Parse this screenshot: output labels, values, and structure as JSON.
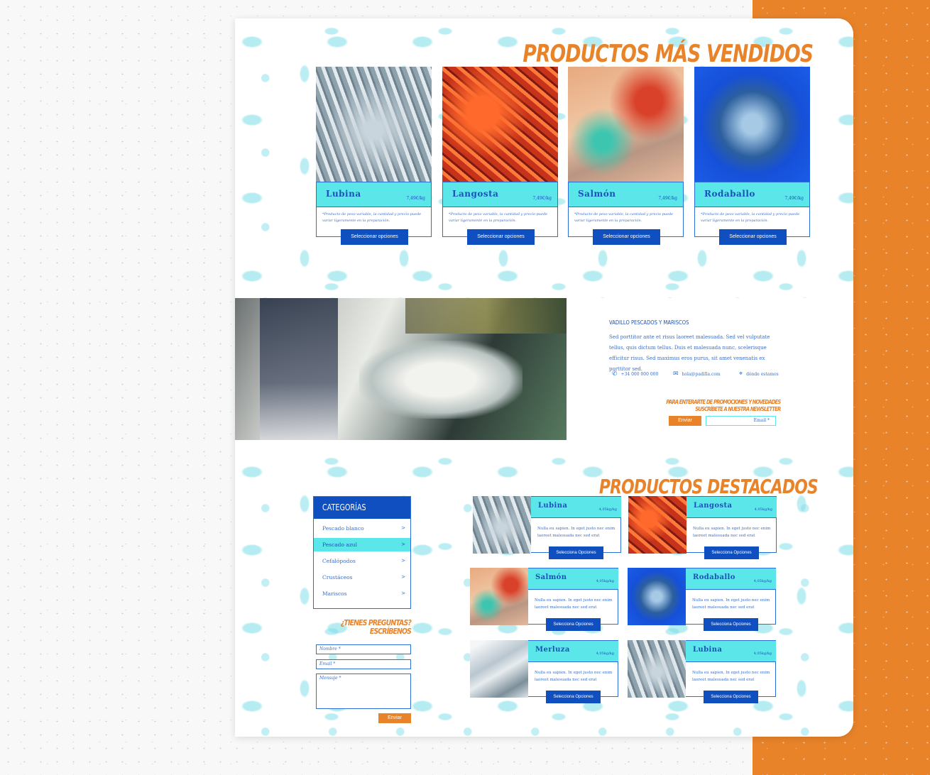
{
  "best_sellers": {
    "title": "PRODUCTOS MÁS VENDIDOS",
    "items": [
      {
        "name": "Lubina",
        "price": "7,49€/kg",
        "note": "*Producto de peso variable, la cantidad y precio puede variar ligeramente en la preparación.",
        "button": "Seleccionar opciones",
        "image": "fish-silver"
      },
      {
        "name": "Langosta",
        "price": "7,49€/kg",
        "note": "*Producto de peso variable, la cantidad y precio puede variar ligeramente en la preparación.",
        "button": "Seleccionar opciones",
        "image": "fish-red"
      },
      {
        "name": "Salmón",
        "price": "7,49€/kg",
        "note": "*Producto de peso variable, la cantidad y precio puede variar ligeramente en la preparación.",
        "button": "Seleccionar opciones",
        "image": "fish-parrot"
      },
      {
        "name": "Rodaballo",
        "price": "7,49€/kg",
        "note": "*Producto de peso variable, la cantidad y precio puede variar ligeramente en la preparación.",
        "button": "Seleccionar opciones",
        "image": "fish-blue"
      }
    ]
  },
  "about": {
    "title": "VADILLO PESCADOS Y MARISCOS",
    "text": "Sed porttitor ante et risus laoreet malesuada. Sed vel vulputate tellus, quis dictum tellus. Duis et malesuada nunc, scelerisque efficitur risus. Sed maximus eros purus, sit amet venenatis ex porttitor sed.",
    "phone": "+34 000 000 000",
    "email": "hola@padilla.com",
    "address": "dónde estamos",
    "promo_line1": "PARA ENTERARTE DE PROMOCIONES Y NOVEDADES",
    "promo_line2": "SUSCRÍBETE A NUESTRA NEWSLETTER",
    "send_label": "Enviar",
    "email_placeholder": "Email *"
  },
  "categories": {
    "title": "CATEGORÍAS",
    "items": [
      {
        "label": "Pescado blanco",
        "arrow": ">"
      },
      {
        "label": "Pescado azul",
        "arrow": ">"
      },
      {
        "label": "Cefalópodos",
        "arrow": ">"
      },
      {
        "label": "Crustáceos",
        "arrow": ">"
      },
      {
        "label": "Mariscos",
        "arrow": ">"
      }
    ],
    "active_index": 1
  },
  "contact_form": {
    "title_line1": "¿TIENES PREGUNTAS?",
    "title_line2": "ESCRÍBENOS",
    "name_placeholder": "Nombre *",
    "email_placeholder": "Email *",
    "message_placeholder": "Mensaje *",
    "send_label": "Enviar"
  },
  "featured": {
    "title": "PRODUCTOS DESTACADOS",
    "items": [
      {
        "name": "Lubina",
        "price": "4,05kg/kg",
        "desc": "Nulla eu sapien. In eget justo nec enim laoreet malesuada nec sed erat",
        "button": "Selecciona Opciones",
        "image": "fish-silver"
      },
      {
        "name": "Langosta",
        "price": "4,05kg/kg",
        "desc": "Nulla eu sapien. In eget justo nec enim laoreet malesuada nec sed erat",
        "button": "Selecciona Opciones",
        "image": "fish-red"
      },
      {
        "name": "Salmón",
        "price": "4,05kg/kg",
        "desc": "Nulla eu sapien. In eget justo nec enim laoreet malesuada nec sed erat",
        "button": "Selecciona Opciones",
        "image": "fish-parrot"
      },
      {
        "name": "Rodaballo",
        "price": "4,05kg/kg",
        "desc": "Nulla eu sapien. In eget justo nec enim laoreet malesuada nec sed erat",
        "button": "Selecciona Opciones",
        "image": "fish-blue"
      },
      {
        "name": "Merluza",
        "price": "4,05kg/kg",
        "desc": "Nulla eu sapien. In eget justo nec enim laoreet malesuada nec sed erat",
        "button": "Selecciona Opciones",
        "image": "fish-hake"
      },
      {
        "name": "Lubina",
        "price": "4,05kg/kg",
        "desc": "Nulla eu sapien. In eget justo nec enim laoreet malesuada nec sed erat",
        "button": "Selecciona Opciones",
        "image": "fish-silver"
      }
    ]
  },
  "colors": {
    "orange": "#e8832a",
    "blue": "#0f4fbf",
    "cyan": "#5be7ea"
  }
}
